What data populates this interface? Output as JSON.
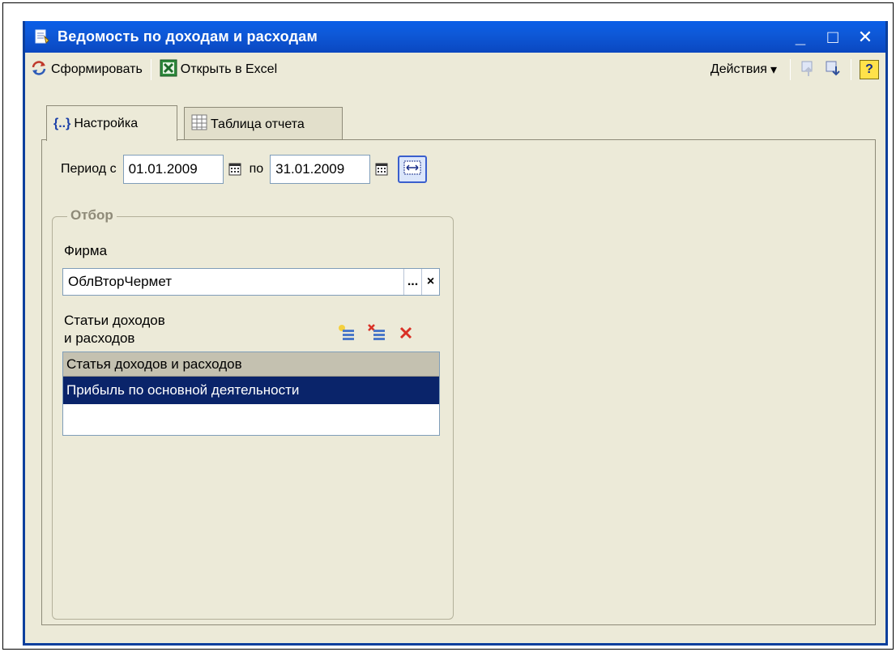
{
  "window": {
    "title": "Ведомость по доходам и расходам",
    "controls": {
      "minimize": "_",
      "maximize": "□",
      "close": "✕"
    }
  },
  "toolbar": {
    "form_label": "Сформировать",
    "excel_label": "Открыть в Excel",
    "actions_label": "Действия",
    "actions_arrow": "▾",
    "help_label": "?"
  },
  "tabs": [
    {
      "label": "Настройка",
      "active": true,
      "icon": "braces-icon"
    },
    {
      "label": "Таблица отчета",
      "active": false,
      "icon": "table-icon"
    }
  ],
  "period": {
    "label_from": "Период с",
    "from": "01.01.2009",
    "label_to": "по",
    "to": "31.01.2009"
  },
  "filter": {
    "title": "Отбор",
    "firm_label": "Фирма",
    "firm_value": "ОблВторЧермет",
    "firm_select_btn": "...",
    "firm_clear_btn": "×",
    "items_label_line1": "Статьи доходов",
    "items_label_line2": "и расходов",
    "table": {
      "header": "Статья доходов и расходов",
      "rows": [
        "Прибыль по основной деятельности"
      ]
    }
  },
  "colors": {
    "titlebar": "#0a5ee8",
    "selection": "#0a246a",
    "window_bg": "#ecead8"
  }
}
